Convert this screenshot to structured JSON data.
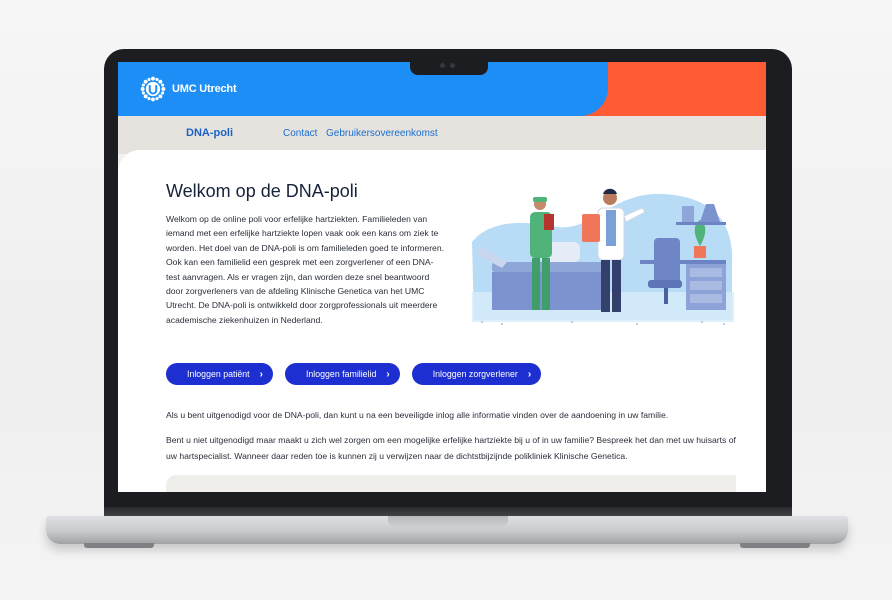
{
  "site": {
    "logo_text": "UMC Utrecht",
    "colors": {
      "header_blue": "#1d8ef5",
      "header_orange": "#ff5b35",
      "button": "#1d2fd0"
    }
  },
  "nav": {
    "brand": "DNA-poli",
    "contact": "Contact",
    "terms": "Gebruikersovereenkomst"
  },
  "main": {
    "title": "Welkom op de DNA-poli",
    "intro": "Welkom op de online poli voor erfelijke hartziekten. Familieleden van iemand met een erfelijke hartziekte lopen vaak ook een kans om ziek te worden. Het doel van de DNA-poli is om familieleden goed te informeren. Ook kan een familielid een gesprek met een zorgverlener of een DNA-test aanvragen. Als er vragen zijn, dan worden deze snel beantwoord door zorgverleners van de afdeling Klinische Genetica van het UMC Utrecht. De DNA-poli is ontwikkeld door zorgprofessionals uit meerdere academische ziekenhuizen in Nederland.",
    "buttons": {
      "patient": "Inloggen patiënt",
      "family": "Inloggen familielid",
      "care": "Inloggen zorgverlener"
    },
    "paragraph1": "Als u bent uitgenodigd voor de DNA-poli, dan kunt u na een beveiligde inlog alle informatie vinden over de aandoening in uw familie.",
    "paragraph2": "Bent u niet uitgenodigd maar maakt u zich wel zorgen om een mogelijke erfelijke hartziekte bij u of in uw familie? Bespreek het dan met uw huisarts of uw hartspecialist. Wanneer daar reden toe is kunnen zij u verwijzen naar de dichtstbijzijnde polikliniek Klinische Genetica."
  },
  "icons": {
    "logo": "umc-sun-logo-icon",
    "chevron": "chevron-right-icon"
  }
}
